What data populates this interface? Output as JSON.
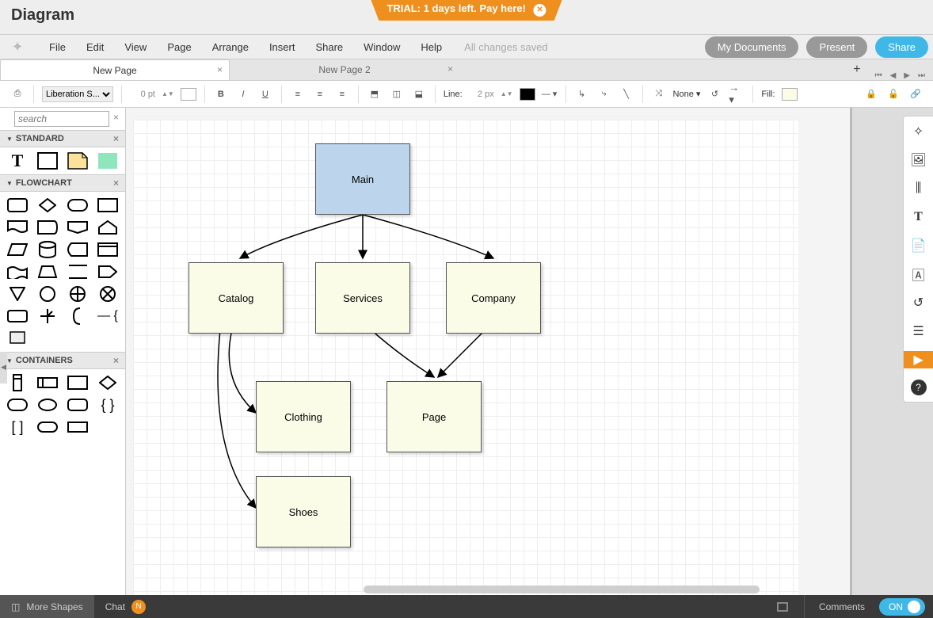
{
  "trial": {
    "text": "TRIAL: 1 days left. Pay here!"
  },
  "app": {
    "title": "Diagram"
  },
  "menu": {
    "items": [
      "File",
      "Edit",
      "View",
      "Page",
      "Arrange",
      "Insert",
      "Share",
      "Window",
      "Help"
    ],
    "saved": "All changes saved"
  },
  "header_buttons": {
    "docs": "My Documents",
    "present": "Present",
    "share": "Share"
  },
  "tabs": {
    "items": [
      {
        "label": "New Page",
        "active": true
      },
      {
        "label": "New Page 2",
        "active": false
      }
    ],
    "add": "+"
  },
  "toolbar": {
    "font": "Liberation S...",
    "font_size": "0 pt",
    "line_label": "Line:",
    "line_px": "2 px",
    "arrow_style": "None",
    "fill_label": "Fill:"
  },
  "search": {
    "placeholder": "search"
  },
  "panels": {
    "standard": "STANDARD",
    "flowchart": "FLOWCHART",
    "containers": "CONTAINERS"
  },
  "nodes": {
    "main": "Main",
    "catalog": "Catalog",
    "services": "Services",
    "company": "Company",
    "clothing": "Clothing",
    "page": "Page",
    "shoes": "Shoes"
  },
  "status": {
    "more": "More Shapes",
    "chat": "Chat",
    "chat_badge": "N",
    "comments": "Comments",
    "toggle": "ON"
  }
}
